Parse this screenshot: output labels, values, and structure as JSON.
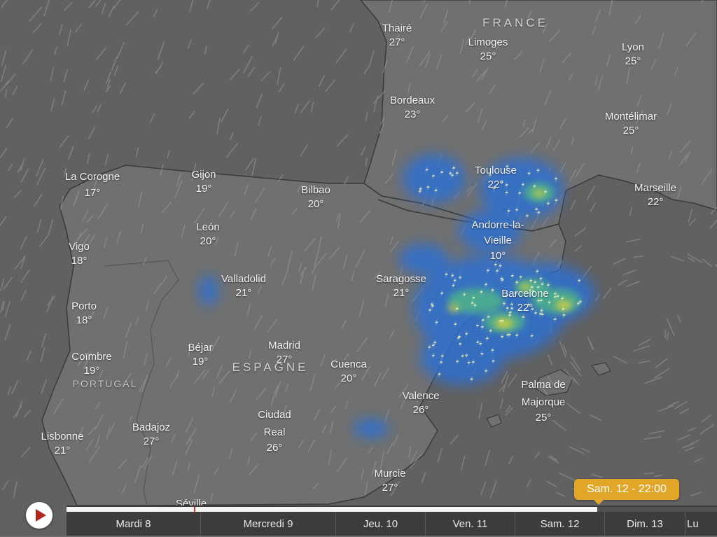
{
  "map": {
    "countries": [
      {
        "name": "FRANCE"
      },
      {
        "name": "ESPAGNE"
      },
      {
        "name": "PORTUGAL"
      }
    ],
    "cities": [
      {
        "name": "Thairé",
        "temp": "27°"
      },
      {
        "name": "Limoges",
        "temp": "25°"
      },
      {
        "name": "Lyon",
        "temp": "25°"
      },
      {
        "name": "Bordeaux",
        "temp": "23°"
      },
      {
        "name": "Montélimar",
        "temp": "25°"
      },
      {
        "name": "Toulouse",
        "temp": "22°"
      },
      {
        "name": "Marseille",
        "temp": "22°"
      },
      {
        "name": "La Corogne",
        "temp": "17°"
      },
      {
        "name": "Gijon",
        "temp": "19°"
      },
      {
        "name": "Bilbao",
        "temp": "20°"
      },
      {
        "name": "León",
        "temp": "20°"
      },
      {
        "name": "Andorre-la-Vieille",
        "temp": "10°"
      },
      {
        "name": "Vigo",
        "temp": "18°"
      },
      {
        "name": "Valladolid",
        "temp": "21°"
      },
      {
        "name": "Saragosse",
        "temp": "21°"
      },
      {
        "name": "Barcelone",
        "temp": "22°"
      },
      {
        "name": "Porto",
        "temp": "18°"
      },
      {
        "name": "Béjar",
        "temp": "19°"
      },
      {
        "name": "Madrid",
        "temp": "27°"
      },
      {
        "name": "Cuenca",
        "temp": "20°"
      },
      {
        "name": "Coïmbre",
        "temp": "19°"
      },
      {
        "name": "Palma de Majorque",
        "temp": "25°"
      },
      {
        "name": "Valence",
        "temp": "26°"
      },
      {
        "name": "Ciudad Real",
        "temp": "26°"
      },
      {
        "name": "Badajoz",
        "temp": "27°"
      },
      {
        "name": "Lisbonne",
        "temp": "21°"
      },
      {
        "name": "Murcie",
        "temp": "27°"
      },
      {
        "name": "Séville",
        "temp": ""
      }
    ]
  },
  "timeline": {
    "current_time_label": "Sam. 12 - 22:00",
    "progress_fraction": 0.816,
    "days": [
      "Mardi 8",
      "Mercredi 9",
      "Jeu. 10",
      "Ven. 11",
      "Sam. 12",
      "Dim. 13",
      "Lu"
    ],
    "play_icon": "play-icon"
  },
  "colors": {
    "background": "#6b6b6b",
    "land": "#6e6e6e",
    "sea": "#5f5f5f",
    "precip_low": "#2f6fd0",
    "precip_mid": "#4db38a",
    "precip_high": "#d6d23a",
    "tooltip": "#e2a628",
    "play_triangle": "#b5271e"
  }
}
